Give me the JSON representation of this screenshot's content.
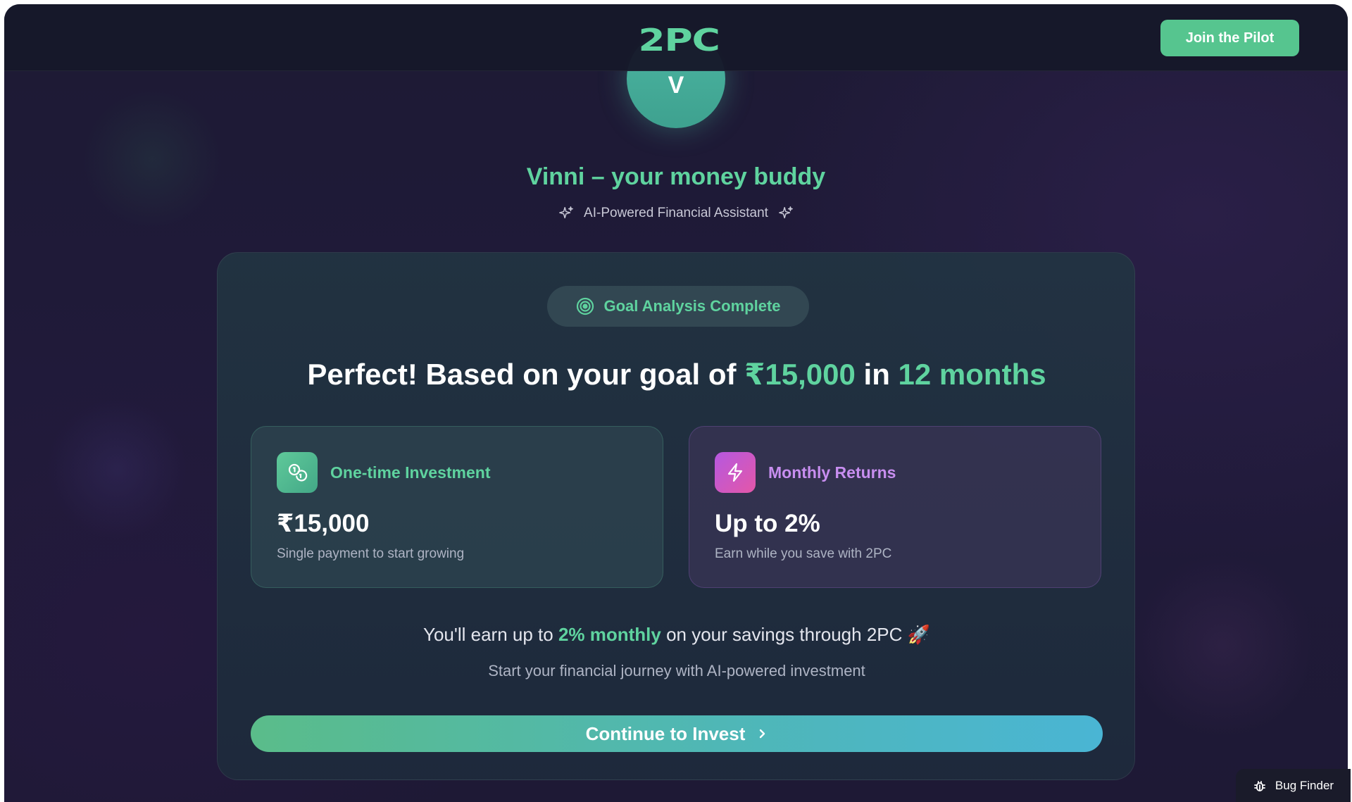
{
  "header": {
    "logo_text": "2PC",
    "join_button_label": "Join the Pilot"
  },
  "assistant": {
    "avatar_letter": "V",
    "name": "Vinni – your money buddy",
    "tagline": "AI-Powered Financial Assistant"
  },
  "card": {
    "badge_label": "Goal Analysis Complete",
    "headline_prefix": "Perfect! Based on your goal of ",
    "goal_amount": "₹15,000",
    "headline_mid": " in ",
    "goal_duration": "12 months",
    "investment": {
      "title": "One-time Investment",
      "value": "₹15,000",
      "description": "Single payment to start growing"
    },
    "returns": {
      "title": "Monthly Returns",
      "value": "Up to 2%",
      "description": "Earn while you save with 2PC"
    },
    "earn_prefix": "You'll earn up to ",
    "earn_highlight": "2% monthly",
    "earn_suffix": " on your savings through 2PC 🚀",
    "journey_text": "Start your financial journey with AI-powered investment",
    "cta_label": "Continue to Invest"
  },
  "bug_finder_label": "Bug Finder",
  "colors": {
    "accent_green": "#5fd39f",
    "accent_purple": "#c88ef0",
    "button_green": "#56c58f",
    "background": "#1e1935"
  },
  "icons": [
    "sparkle-icon",
    "target-icon",
    "coins-icon",
    "lightning-icon",
    "chevron-right-icon",
    "bug-icon"
  ]
}
